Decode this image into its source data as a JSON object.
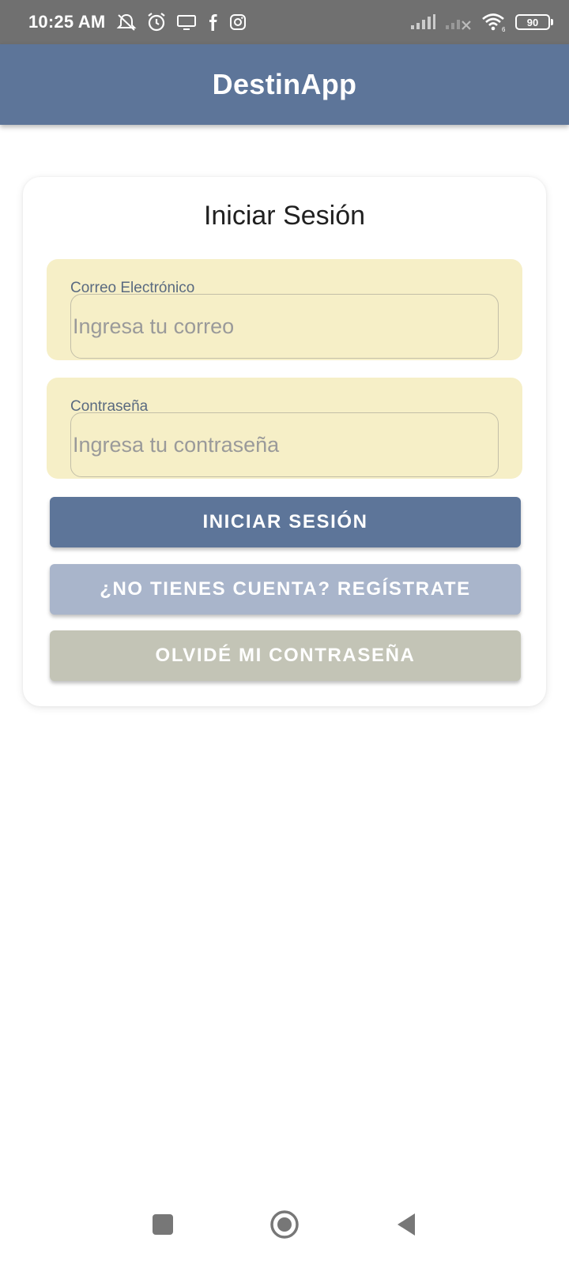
{
  "status_bar": {
    "time": "10:25 AM",
    "battery": "90",
    "left_icons": [
      "mute-icon",
      "alarm-icon",
      "screen-icon",
      "facebook-icon",
      "instagram-icon"
    ],
    "right_icons": [
      "signal-icon",
      "signal-no-service-icon",
      "wifi-icon",
      "battery-icon"
    ]
  },
  "app_bar": {
    "title": "DestinApp",
    "color": "#5d7599"
  },
  "login_card": {
    "title": "Iniciar Sesión",
    "email_field": {
      "label": "Correo Electrónico",
      "placeholder": "Ingresa tu correo",
      "value": ""
    },
    "password_field": {
      "label": "Contraseña",
      "placeholder": "Ingresa tu contraseña",
      "value": ""
    },
    "buttons": {
      "login": "INICIAR SESIÓN",
      "register": "¿NO TIENES CUENTA? REGÍSTRATE",
      "forgot_password": "OLVIDÉ MI CONTRASEÑA"
    },
    "colors": {
      "field_background": "#f6efc7",
      "login_button": "#5d7599",
      "register_button": "#a9b5cb",
      "forgot_button": "#c3c4b6"
    }
  },
  "nav_bar": {
    "icons": [
      "recents-square-icon",
      "home-circle-icon",
      "back-triangle-icon"
    ]
  }
}
